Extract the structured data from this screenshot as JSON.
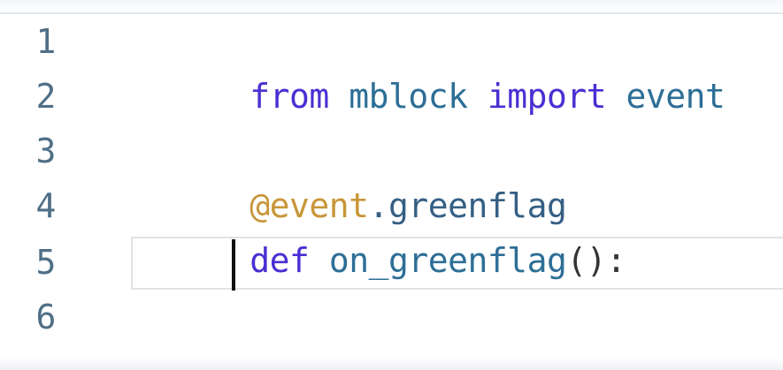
{
  "editor": {
    "lines": [
      {
        "number": "1",
        "tokens": [
          {
            "text": "from",
            "type": "keyword"
          },
          {
            "text": " ",
            "type": "space"
          },
          {
            "text": "mblock",
            "type": "identifier"
          },
          {
            "text": " ",
            "type": "space"
          },
          {
            "text": "import",
            "type": "keyword"
          },
          {
            "text": " ",
            "type": "space"
          },
          {
            "text": "event",
            "type": "identifier"
          }
        ]
      },
      {
        "number": "2",
        "tokens": []
      },
      {
        "number": "3",
        "tokens": [
          {
            "text": "@event",
            "type": "decorator_at"
          },
          {
            "text": ".greenflag",
            "type": "decorator_name"
          }
        ]
      },
      {
        "number": "4",
        "tokens": [
          {
            "text": "def",
            "type": "keyword"
          },
          {
            "text": " ",
            "type": "space"
          },
          {
            "text": "on_greenflag",
            "type": "identifier"
          },
          {
            "text": "():",
            "type": "punctuation"
          }
        ]
      },
      {
        "number": "5",
        "tokens": []
      },
      {
        "number": "6",
        "tokens": []
      }
    ],
    "colors": {
      "keyword": "#4b2ed3",
      "identifier": "#2d6e96",
      "decorator_at": "#c89638",
      "decorator_name": "#355f84",
      "punctuation": "#343434",
      "line_number": "#4f6f86"
    }
  }
}
